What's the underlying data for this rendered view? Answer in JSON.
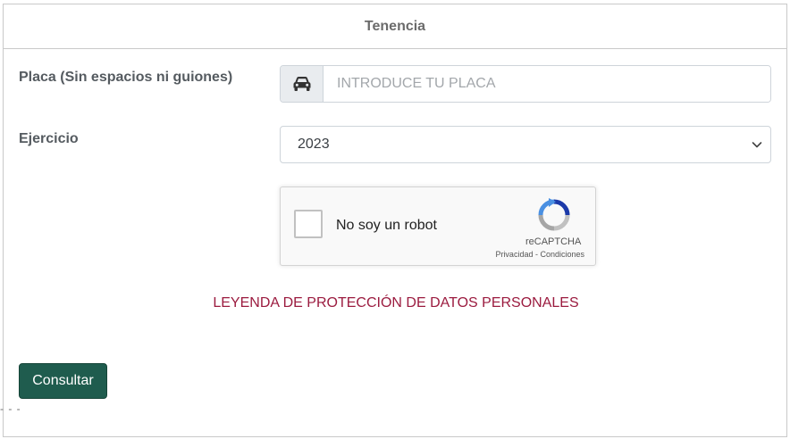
{
  "header": {
    "title": "Tenencia"
  },
  "form": {
    "placa_label": "Placa (Sin espacios ni guiones)",
    "placa_placeholder": "INTRODUCE TU PLACA",
    "placa_value": "",
    "placa_icon": "car-icon",
    "ejercicio_label": "Ejercicio",
    "ejercicio_selected": "2023"
  },
  "recaptcha": {
    "label": "No soy un robot",
    "brand": "reCAPTCHA",
    "privacy": "Privacidad",
    "separator": " - ",
    "terms": "Condiciones"
  },
  "legend": "LEYENDA DE PROTECCIÓN DE DATOS PERSONALES",
  "actions": {
    "submit_label": "Consultar"
  },
  "footer": {
    "dashes": "- - -"
  },
  "colors": {
    "primary_button": "#1f5c4e",
    "legend_text": "#9b1b3f",
    "label_text": "#555b60"
  }
}
